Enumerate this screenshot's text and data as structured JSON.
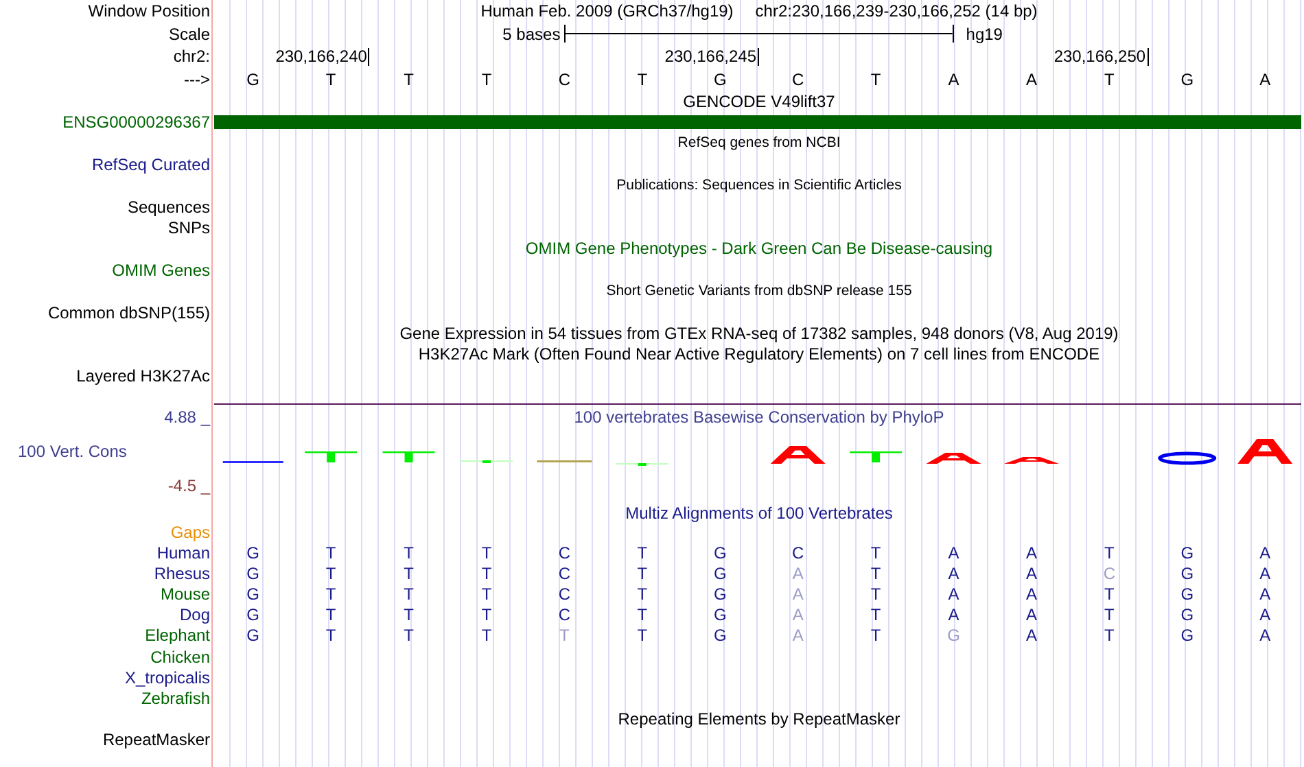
{
  "position_bar": {
    "label": "Window Position",
    "assembly": "Human Feb. 2009 (GRCh37/hg19)",
    "position": "chr2:230,166,239-230,166,252 (14 bp)"
  },
  "scale": {
    "label": "Scale",
    "length": "5 bases",
    "db": "hg19"
  },
  "ruler": {
    "label": "chr2:",
    "ticks": [
      "230,166,240",
      "230,166,245",
      "230,166,250"
    ]
  },
  "sequence": {
    "label": "--->",
    "bases": [
      "G",
      "T",
      "T",
      "T",
      "C",
      "T",
      "G",
      "C",
      "T",
      "A",
      "A",
      "T",
      "G",
      "A"
    ]
  },
  "tracks": [
    {
      "kind": "gene",
      "title": "GENCODE V49lift37",
      "label": "ENSG00000296367",
      "color": "#006400"
    },
    {
      "kind": "dense",
      "title": "RefSeq genes from NCBI",
      "label": "RefSeq Curated",
      "color": "#1a1a8a"
    },
    {
      "kind": "dense",
      "title": "Publications: Sequences in Scientific Articles",
      "label": "Sequences",
      "color": "#000000"
    },
    {
      "kind": "label",
      "label": "SNPs",
      "color": "#000000"
    },
    {
      "kind": "full",
      "title": "OMIM Gene Phenotypes - Dark Green Can Be Disease-causing",
      "label": "OMIM Genes",
      "color": "#006400"
    },
    {
      "kind": "dense",
      "title": "Short Genetic Variants from dbSNP release 155",
      "label": "Common dbSNP(155)",
      "color": "#000000"
    },
    {
      "kind": "title",
      "title": "Gene Expression in 54 tissues from GTEx RNA-seq of 17382 samples, 948 donors (V8, Aug 2019)"
    },
    {
      "kind": "full",
      "title": "H3K27Ac Mark (Often Found Near Active Regulatory Elements) on 7 cell lines from ENCODE",
      "label": "Layered H3K27Ac",
      "color": "#000000"
    }
  ],
  "conservation": {
    "title": "100 vertebrates Basewise Conservation by PhyloP",
    "label": "100 Vert. Cons",
    "max_label": "4.88 _",
    "min_label": "-4.5 _"
  },
  "multiz": {
    "title": "Multiz Alignments of 100 Vertebrates",
    "gaps_label": "Gaps",
    "species": [
      {
        "name": "Human",
        "color": "#1a1a8a",
        "bases": [
          {
            "base": "G",
            "differs": false
          },
          {
            "base": "T",
            "differs": false
          },
          {
            "base": "T",
            "differs": false
          },
          {
            "base": "T",
            "differs": false
          },
          {
            "base": "C",
            "differs": false
          },
          {
            "base": "T",
            "differs": false
          },
          {
            "base": "G",
            "differs": false
          },
          {
            "base": "C",
            "differs": false
          },
          {
            "base": "T",
            "differs": false
          },
          {
            "base": "A",
            "differs": false
          },
          {
            "base": "A",
            "differs": false
          },
          {
            "base": "T",
            "differs": false
          },
          {
            "base": "G",
            "differs": false
          },
          {
            "base": "A",
            "differs": false
          }
        ]
      },
      {
        "name": "Rhesus",
        "color": "#1a1a8a",
        "bases": [
          {
            "base": "G",
            "differs": false
          },
          {
            "base": "T",
            "differs": false
          },
          {
            "base": "T",
            "differs": false
          },
          {
            "base": "T",
            "differs": false
          },
          {
            "base": "C",
            "differs": false
          },
          {
            "base": "T",
            "differs": false
          },
          {
            "base": "G",
            "differs": false
          },
          {
            "base": "A",
            "differs": true
          },
          {
            "base": "T",
            "differs": false
          },
          {
            "base": "A",
            "differs": false
          },
          {
            "base": "A",
            "differs": false
          },
          {
            "base": "C",
            "differs": true
          },
          {
            "base": "G",
            "differs": false
          },
          {
            "base": "A",
            "differs": false
          }
        ]
      },
      {
        "name": "Mouse",
        "color": "#006400",
        "bases": [
          {
            "base": "G",
            "differs": false
          },
          {
            "base": "T",
            "differs": false
          },
          {
            "base": "T",
            "differs": false
          },
          {
            "base": "T",
            "differs": false
          },
          {
            "base": "C",
            "differs": false
          },
          {
            "base": "T",
            "differs": false
          },
          {
            "base": "G",
            "differs": false
          },
          {
            "base": "A",
            "differs": true
          },
          {
            "base": "T",
            "differs": false
          },
          {
            "base": "A",
            "differs": false
          },
          {
            "base": "A",
            "differs": false
          },
          {
            "base": "T",
            "differs": false
          },
          {
            "base": "G",
            "differs": false
          },
          {
            "base": "A",
            "differs": false
          }
        ]
      },
      {
        "name": "Dog",
        "color": "#1a1a8a",
        "bases": [
          {
            "base": "G",
            "differs": false
          },
          {
            "base": "T",
            "differs": false
          },
          {
            "base": "T",
            "differs": false
          },
          {
            "base": "T",
            "differs": false
          },
          {
            "base": "C",
            "differs": false
          },
          {
            "base": "T",
            "differs": false
          },
          {
            "base": "G",
            "differs": false
          },
          {
            "base": "A",
            "differs": true
          },
          {
            "base": "T",
            "differs": false
          },
          {
            "base": "A",
            "differs": false
          },
          {
            "base": "A",
            "differs": false
          },
          {
            "base": "T",
            "differs": false
          },
          {
            "base": "G",
            "differs": false
          },
          {
            "base": "A",
            "differs": false
          }
        ]
      },
      {
        "name": "Elephant",
        "color": "#006400",
        "bases": [
          {
            "base": "G",
            "differs": false
          },
          {
            "base": "T",
            "differs": false
          },
          {
            "base": "T",
            "differs": false
          },
          {
            "base": "T",
            "differs": false
          },
          {
            "base": "T",
            "differs": true
          },
          {
            "base": "T",
            "differs": false
          },
          {
            "base": "G",
            "differs": false
          },
          {
            "base": "A",
            "differs": true
          },
          {
            "base": "T",
            "differs": false
          },
          {
            "base": "G",
            "differs": true
          },
          {
            "base": "A",
            "differs": false
          },
          {
            "base": "T",
            "differs": false
          },
          {
            "base": "G",
            "differs": false
          },
          {
            "base": "A",
            "differs": false
          }
        ]
      },
      {
        "name": "Chicken",
        "color": "#006400"
      },
      {
        "name": "X_tropicalis",
        "color": "#1a1a8a"
      },
      {
        "name": "Zebrafish",
        "color": "#006400"
      }
    ]
  },
  "repeats": {
    "title": "Repeating Elements by RepeatMasker",
    "label": "RepeatMasker"
  }
}
